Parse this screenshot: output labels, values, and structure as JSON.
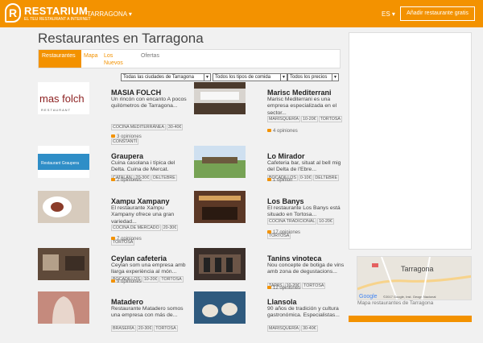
{
  "header": {
    "logo_name": "RESTARIUM",
    "logo_tagline": "EL TEU RESTAURANT A INTERNET",
    "city": "TARRAGONA ▾",
    "lang": "ES ▾",
    "add_button": "Añadir restaurante gratis"
  },
  "page": {
    "title": "Restaurantes en Tarragona",
    "tabs": [
      {
        "label": "Restaurantes"
      },
      {
        "label": "Mapa"
      },
      {
        "label": "Los Nuevos"
      },
      {
        "label": "Ofertas"
      }
    ],
    "filters": [
      {
        "label": "Todas las ciudades de Tarragona"
      },
      {
        "label": "Todos los tipos de comida"
      },
      {
        "label": "Todos los precios"
      }
    ]
  },
  "restaurants_left": [
    {
      "name": "MASIA FOLCH",
      "desc": "Un rincón con encanto A pocos quilómetros de Tarragona...",
      "tags": [
        "COCINA MEDITERRÁNEA",
        "30-40€",
        "CONSTANTÍ"
      ],
      "reviews": "3 opiniones"
    },
    {
      "name": "Graupera",
      "desc": "Cuina casolana i típica del Delta. Cuina de Mercat.",
      "tags": [
        "CATALÁN",
        "20-30€",
        "DELTEBRE"
      ],
      "reviews": "2 opiniones"
    },
    {
      "name": "Xampu Xampany",
      "desc": "El restaurante Xampu Xampany ofrece una gran variedad...",
      "tags": [
        "COCINA DE MERCADO",
        "20-30€",
        "TORTOSA"
      ],
      "reviews": "7 opiniones"
    },
    {
      "name": "Ceylan cafeteria",
      "desc": "Ceylan som una empresa amb llarga experiència al món...",
      "tags": [
        "BOCADILLOS",
        "10-20€",
        "TORTOSA"
      ],
      "reviews": "9 opiniones"
    },
    {
      "name": "Matadero",
      "desc": "Restaurante Matadero somos una empresa con más de...",
      "tags": [
        "BRASERÍA",
        "20-30€",
        "TORTOSA"
      ],
      "reviews": ""
    }
  ],
  "restaurants_right": [
    {
      "name": "Marisc Mediterrani",
      "desc": "Marisc Mediterrani es una empresa especializada en el sector...",
      "tags": [
        "MARISQUERÍA",
        "10-20€",
        "TORTOSA"
      ],
      "reviews": "4 opiniones"
    },
    {
      "name": "Lo Mirador",
      "desc": "Cafeteria bar, situat al bell mig del Delta de l'Ebre...",
      "tags": [
        "BOCADILLOS",
        "0-10€",
        "DELTEBRE"
      ],
      "reviews": "1 opinion"
    },
    {
      "name": "Los Banys",
      "desc": "El restaurante Los Banys está situado en Tortosa...",
      "tags": [
        "COCINA TRADICIONAL",
        "10-20€",
        "TORTOSA"
      ],
      "reviews": "17 opiniones"
    },
    {
      "name": "Tanins vinoteca",
      "desc": "Nou concepte de botiga de vins amb zona de degustacions...",
      "tags": [
        "TAPAS",
        "10-20€",
        "TORTOSA"
      ],
      "reviews": "12 opiniones"
    },
    {
      "name": "Llansola",
      "desc": "90 años de tradición y cultura gastronómica. Especialistas...",
      "tags": [
        "MARISQUERÍA",
        "30-40€",
        ""
      ],
      "reviews": ""
    }
  ],
  "sidebar": {
    "map_city": "Tarragona",
    "map_copyright": "©2017 Google, Inst. Geogr. Nacional",
    "map_google": "Google",
    "map_label": "Mapa restaurantes de Tarragona"
  }
}
